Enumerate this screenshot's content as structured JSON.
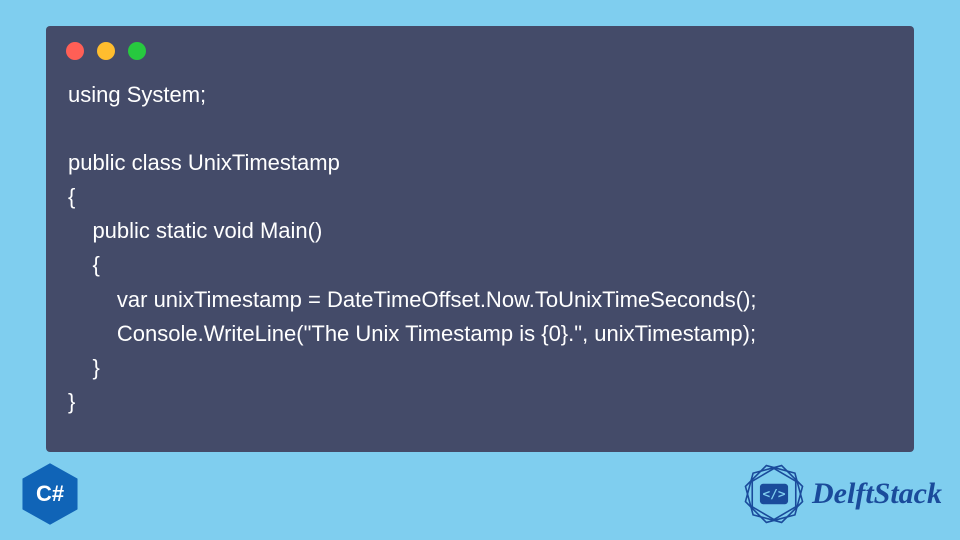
{
  "code": {
    "lines": [
      "using System;",
      "",
      "public class UnixTimestamp",
      "{",
      "    public static void Main()",
      "    {",
      "        var unixTimestamp = DateTimeOffset.Now.ToUnixTimeSeconds();",
      "        Console.WriteLine(\"The Unix Timestamp is {0}.\", unixTimestamp);",
      "    }",
      "}"
    ]
  },
  "badge": {
    "text": "C#"
  },
  "brand": {
    "name": "DelftStack"
  },
  "colors": {
    "page_bg": "#7fceef",
    "window_bg": "#444b69",
    "code_fg": "#ffffff",
    "badge_fill": "#1064b7",
    "brand_color": "#1a4b9b",
    "tl_red": "#ff5f56",
    "tl_yellow": "#ffbd2e",
    "tl_green": "#27c93f"
  }
}
